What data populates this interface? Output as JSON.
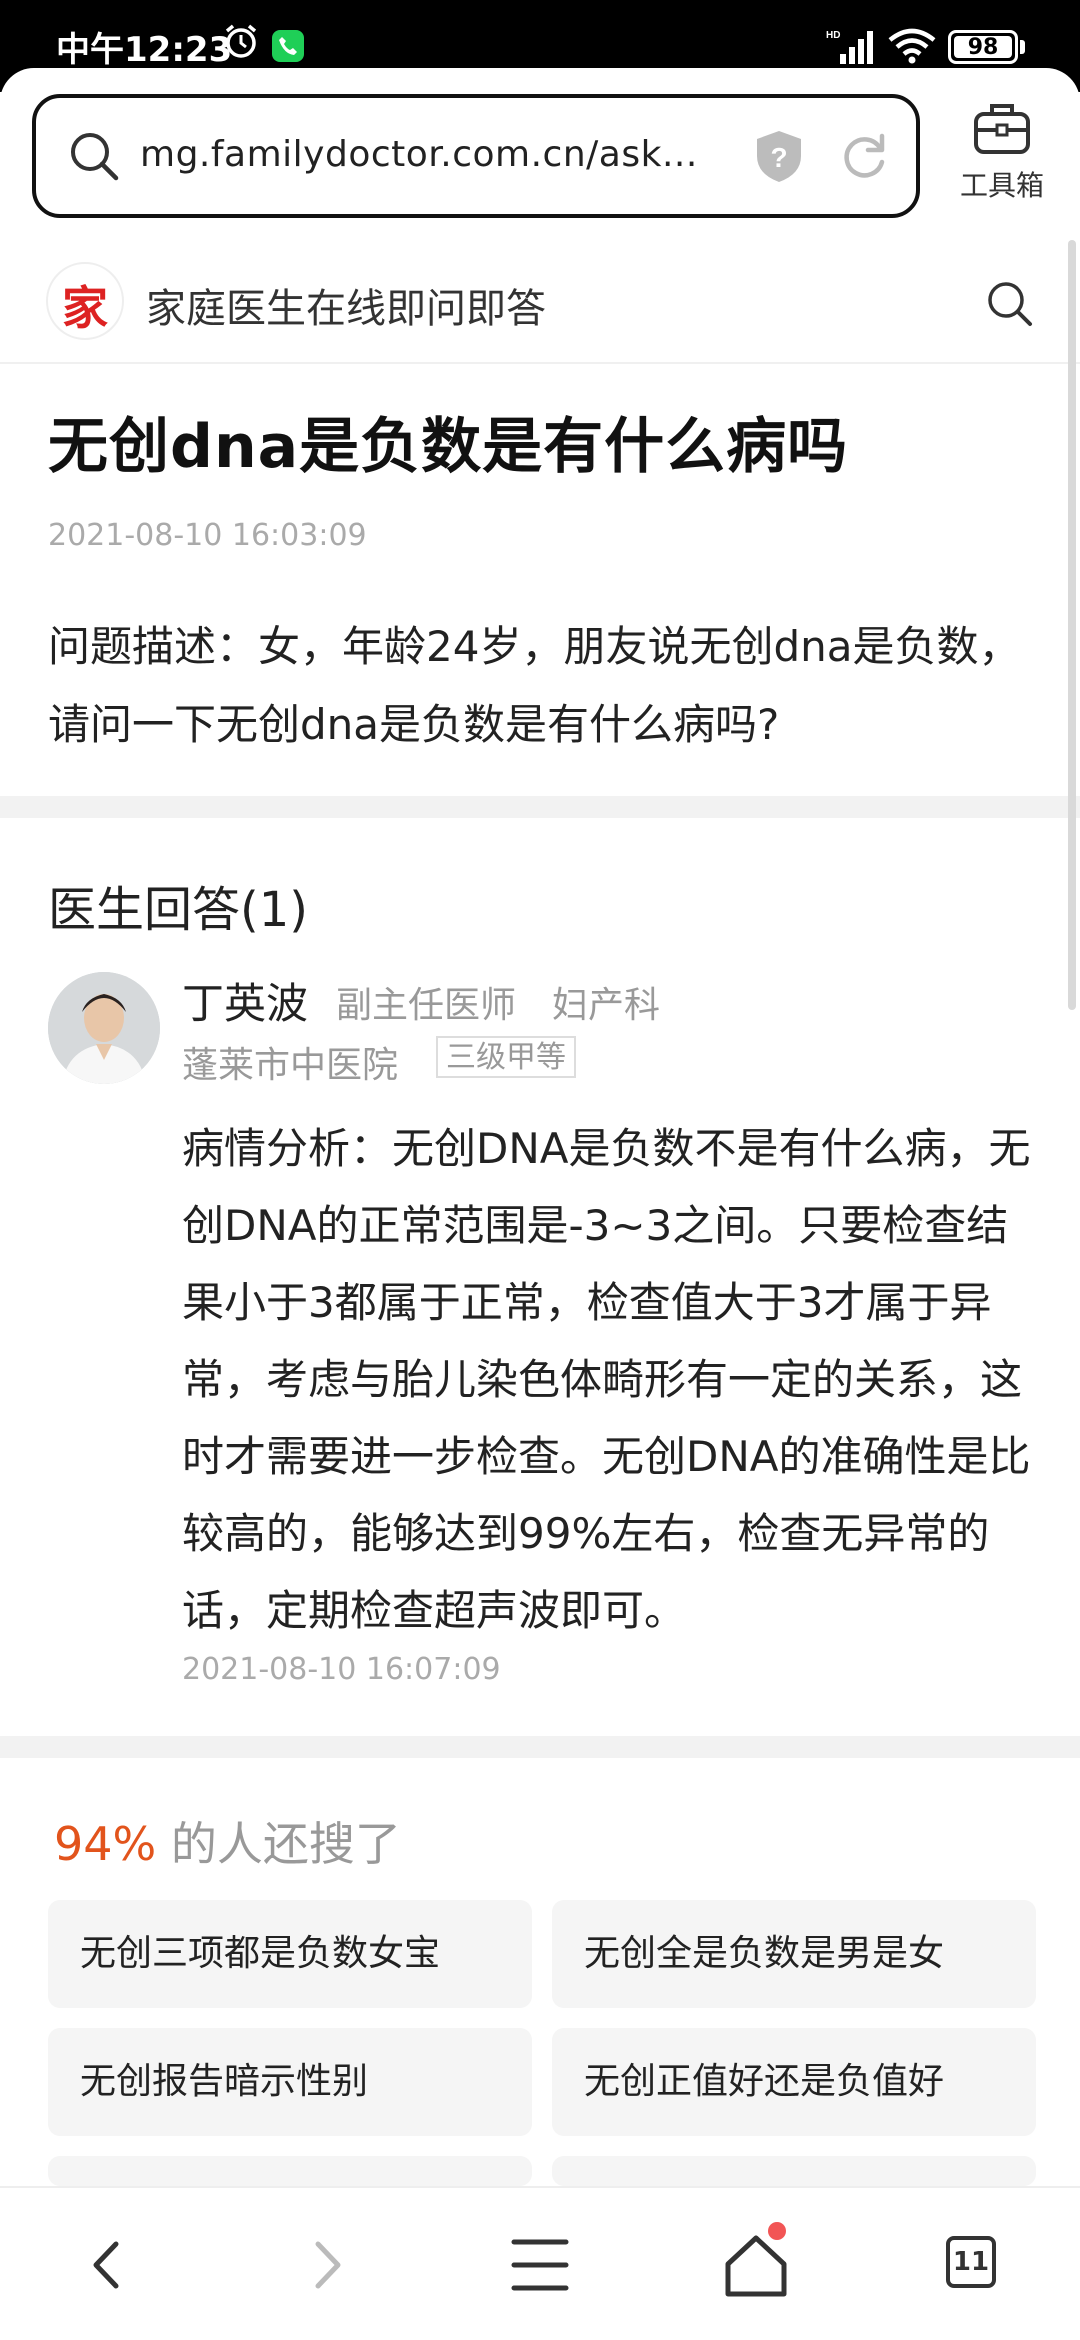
{
  "status": {
    "time": "中午12:23",
    "battery": "98"
  },
  "browser": {
    "url": "mg.familydoctor.com.cn/ask...",
    "toolbox_label": "工具箱"
  },
  "site": {
    "logo_char": "家",
    "title": "家庭医生在线即问即答"
  },
  "question": {
    "title": "无创dna是负数是有什么病吗",
    "date": "2021-08-10 16:03:09",
    "description": "问题描述：女，年龄24岁，朋友说无创dna是负数，请问一下无创dna是负数是有什么病吗?"
  },
  "answers": {
    "heading": "医生回答(1)",
    "doctor": {
      "name": "丁英波",
      "title": "副主任医师",
      "department": "妇产科",
      "hospital": "蓬莱市中医院",
      "grade": "三级甲等"
    },
    "text": "病情分析：无创DNA是负数不是有什么病，无创DNA的正常范围是-3~3之间。只要检查结果小于3都属于正常，检查值大于3才属于异常，考虑与胎儿染色体畸形有一定的关系，这时才需要进一步检查。无创DNA的准确性是比较高的，能够达到99%左右，检查无异常的话，定期检查超声波即可。",
    "date": "2021-08-10 16:07:09"
  },
  "related": {
    "percent": "94%",
    "heading": " 的人还搜了",
    "items": [
      "无创三项都是负数女宝",
      "无创全是负数是男是女",
      "无创报告暗示性别",
      "无创正值好还是负值好"
    ]
  },
  "nav": {
    "tabs_count": "11"
  },
  "colors": {
    "accent": "#e2541c",
    "status_bg": "#000000"
  }
}
